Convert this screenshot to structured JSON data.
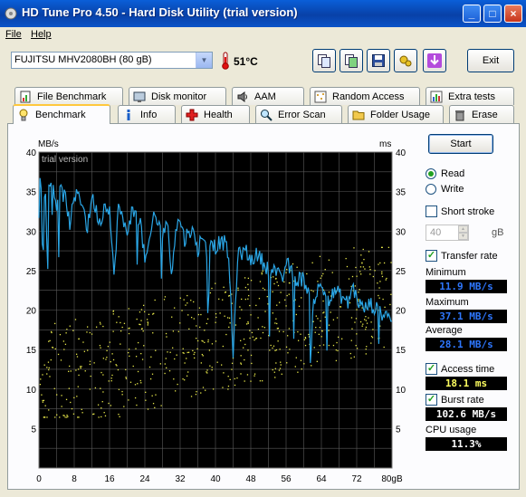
{
  "window": {
    "title": "HD Tune Pro 4.50 - Hard Disk Utility (trial version)",
    "minimize": "_",
    "maximize": "□",
    "close": "×"
  },
  "menu": {
    "file": "File",
    "help": "Help"
  },
  "toolbar": {
    "drive": "FUJITSU MHV2080BH (80 gB)",
    "temperature": "51°C",
    "exit": "Exit",
    "icons": [
      "copy-icon",
      "copy-screenshot-icon",
      "save-icon",
      "options-icon",
      "download-icon"
    ]
  },
  "tabs_row1": [
    {
      "label": "File Benchmark",
      "icon": "file-benchmark-icon"
    },
    {
      "label": "Disk monitor",
      "icon": "disk-monitor-icon"
    },
    {
      "label": "AAM",
      "icon": "speaker-icon"
    },
    {
      "label": "Random Access",
      "icon": "random-access-icon"
    },
    {
      "label": "Extra tests",
      "icon": "extra-tests-icon"
    }
  ],
  "tabs_row2": [
    {
      "label": "Benchmark",
      "icon": "benchmark-icon",
      "active": true
    },
    {
      "label": "Info",
      "icon": "info-icon"
    },
    {
      "label": "Health",
      "icon": "health-cross-icon"
    },
    {
      "label": "Error Scan",
      "icon": "magnifier-icon"
    },
    {
      "label": "Folder Usage",
      "icon": "folder-icon"
    },
    {
      "label": "Erase",
      "icon": "trash-icon"
    }
  ],
  "controls": {
    "start": "Start",
    "read": "Read",
    "write": "Write",
    "mode_selected": "read",
    "short_stroke": "Short stroke",
    "short_stroke_checked": false,
    "short_stroke_value": "40",
    "short_stroke_unit": "gB",
    "transfer_rate": "Transfer rate",
    "transfer_rate_checked": true,
    "minimum_label": "Minimum",
    "minimum": "11.9 MB/s",
    "maximum_label": "Maximum",
    "maximum": "37.1 MB/s",
    "average_label": "Average",
    "average": "28.1 MB/s",
    "access_time": "Access time",
    "access_time_checked": true,
    "access_time_value": "18.1 ms",
    "burst_rate": "Burst rate",
    "burst_rate_checked": true,
    "burst_rate_value": "102.6 MB/s",
    "cpu_usage_label": "CPU usage",
    "cpu_usage": "11.3%",
    "minimum_color": "#2e77ff",
    "access_color": "#ffff60"
  },
  "chart_data": {
    "type": "line",
    "watermark": "trial version",
    "left_unit": "MB/s",
    "right_unit": "ms",
    "x_ticks": [
      "0",
      "8",
      "16",
      "24",
      "32",
      "40",
      "48",
      "56",
      "64",
      "72",
      "80gB"
    ],
    "y_ticks": [
      "5",
      "10",
      "15",
      "20",
      "25",
      "30",
      "35",
      "40"
    ],
    "xlim": [
      0,
      80
    ],
    "ylim": [
      0,
      40
    ],
    "grid": true,
    "colors": {
      "background": "#000000",
      "grid": "#5a5a5a",
      "transfer": "#2aa6e6",
      "access": "#e8e84a"
    },
    "series": [
      {
        "kind": "transfer_rate",
        "x": [
          0,
          1,
          2,
          3,
          4,
          5,
          6,
          7,
          8,
          9,
          10,
          11,
          12,
          13,
          14,
          15,
          16,
          17,
          18,
          19,
          20,
          21,
          22,
          23,
          24,
          25,
          26,
          27,
          28,
          29,
          30,
          31,
          32,
          33,
          34,
          35,
          36,
          37,
          38,
          39,
          40,
          41,
          42,
          43,
          44,
          45,
          46,
          47,
          48,
          49,
          50,
          51,
          52,
          53,
          54,
          55,
          56,
          57,
          58,
          59,
          60,
          61,
          62,
          63,
          64,
          65,
          66,
          67,
          68,
          69,
          70,
          71,
          72,
          73,
          74,
          75,
          76,
          77,
          78,
          79,
          80
        ],
        "y": [
          36.5,
          35.5,
          34.5,
          36.8,
          33.2,
          35.2,
          34.1,
          31.0,
          33.8,
          35.0,
          33.2,
          30.2,
          34.5,
          32.5,
          31.0,
          33.7,
          32.8,
          24.0,
          33.2,
          31.2,
          30.0,
          32.4,
          32.0,
          31.2,
          26.1,
          28.0,
          32.2,
          31.0,
          29.5,
          31.5,
          24.8,
          30.4,
          31.5,
          28.8,
          30.3,
          29.6,
          27.5,
          29.8,
          27.2,
          29.0,
          27.9,
          28.6,
          28.5,
          27.0,
          14.0,
          26.8,
          27.3,
          27.4,
          26.2,
          27.0,
          26.8,
          25.8,
          25.3,
          25.4,
          24.8,
          23.4,
          26.1,
          25.1,
          23.7,
          24.0,
          23.9,
          22.5,
          20.5,
          22.4,
          23.0,
          22.0,
          21.3,
          22.4,
          22.0,
          21.5,
          20.8,
          23.0,
          21.6,
          20.4,
          20.2,
          20.8,
          20.3,
          19.8,
          19.6,
          19.9,
          18.6
        ]
      },
      {
        "kind": "access_time_ms",
        "points": "scatter, ~600 samples spread from 7 to 27 ms"
      }
    ]
  }
}
